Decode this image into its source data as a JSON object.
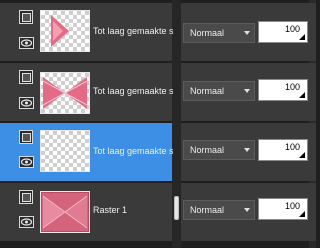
{
  "layers": [
    {
      "name": "Tot laag gemaakte s",
      "blend_mode": "Normaal",
      "opacity": "100",
      "selected": false,
      "thumb": "pink-cross-left"
    },
    {
      "name": "Tot laag gemaakte s",
      "blend_mode": "Normaal",
      "opacity": "100",
      "selected": false,
      "thumb": "pink-bowtie"
    },
    {
      "name": "Tot laag gemaakte s",
      "blend_mode": "Normaal",
      "opacity": "100",
      "selected": true,
      "thumb": "transparent"
    },
    {
      "name": "Raster 1",
      "blend_mode": "Normaal",
      "opacity": "100",
      "selected": false,
      "thumb": "pink-texture"
    }
  ],
  "colors": {
    "selected_row": "#3d8fe6",
    "row_bg": "#3a3a3a",
    "thumb_pink": "#e05a7a"
  },
  "icons": {
    "layer_type": "layer-group-icon",
    "visibility": "eye-icon",
    "dropdown": "chevron-down-icon"
  }
}
